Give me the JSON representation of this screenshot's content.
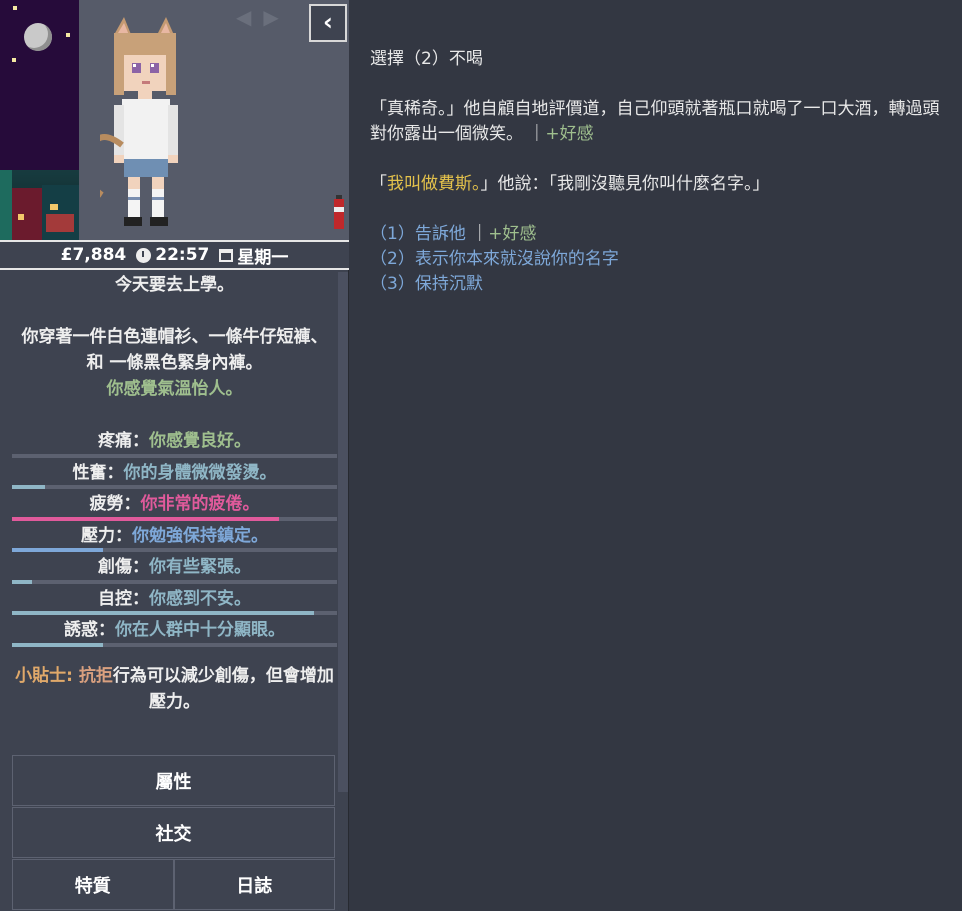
{
  "sidebar": {
    "stats": {
      "money": "£7,884",
      "time": "22:57",
      "weekday": "星期一"
    },
    "status": {
      "line1": "今天要去上學。",
      "clothes": "你穿著一件白色連帽衫、一條牛仔短褲、和 一條黑色緊身內褲。",
      "mood": "你感覺氣溫怡人。"
    },
    "meters": [
      {
        "label": "疼痛：",
        "value": "你感覺良好。",
        "level": 0.0,
        "color": "#9fbf8e"
      },
      {
        "label": "性奮：",
        "value": "你的身體微微發燙。",
        "level": 0.1,
        "color": "#8fb6c6"
      },
      {
        "label": "疲勞：",
        "value": "你非常的疲倦。",
        "level": 0.82,
        "color": "#e05a9b"
      },
      {
        "label": "壓力：",
        "value": "你勉強保持鎮定。",
        "level": 0.28,
        "color": "#7ea8d9"
      },
      {
        "label": "創傷：",
        "value": "你有些緊張。",
        "level": 0.06,
        "color": "#8fb6c6"
      },
      {
        "label": "自控：",
        "value": "你感到不安。",
        "level": 0.93,
        "color": "#8fb6c6"
      },
      {
        "label": "誘惑：",
        "value": "你在人群中十分顯眼。",
        "level": 0.28,
        "color": "#8fb6c6"
      }
    ],
    "tip": {
      "prefix": "小貼士: ",
      "highlight": "抗拒",
      "text": "行為可以減少創傷，但會增加壓力。"
    },
    "tabs": {
      "attributes": "屬性",
      "social": "社交",
      "traits": "特質",
      "journal": "日誌"
    },
    "icons": [
      "back-arrow-icon",
      "forward-arrow-icon",
      "collapse-chevron-icon",
      "clock-icon",
      "calendar-icon"
    ]
  },
  "story": {
    "heading": "選擇（2）不喝",
    "para1": "「真稀奇。」他自顧自地評價道，自己仰頭就著瓶口就喝了一口大酒，轉過頭對你露出一個微笑。",
    "para1_sep": "｜",
    "para1_aff": "+好感",
    "para2_open": "「",
    "para2_name": "我叫做費斯。",
    "para2_rest": "」他說：「我剛沒聽見你叫什麼名字。」",
    "choices": [
      {
        "label": "（1）告訴他",
        "sep": "｜",
        "aff": "+好感"
      },
      {
        "label": "（2）表示你本來就沒說你的名字"
      },
      {
        "label": "（3）保持沉默"
      }
    ]
  },
  "colors": {
    "page_bg": "#333742",
    "sidebar_bg": "#3e4350",
    "green": "#9fbf8e",
    "link_blue": "#7ea8d9",
    "name_yellow": "#e3c14b",
    "tip_orange": "#e0a96a"
  }
}
